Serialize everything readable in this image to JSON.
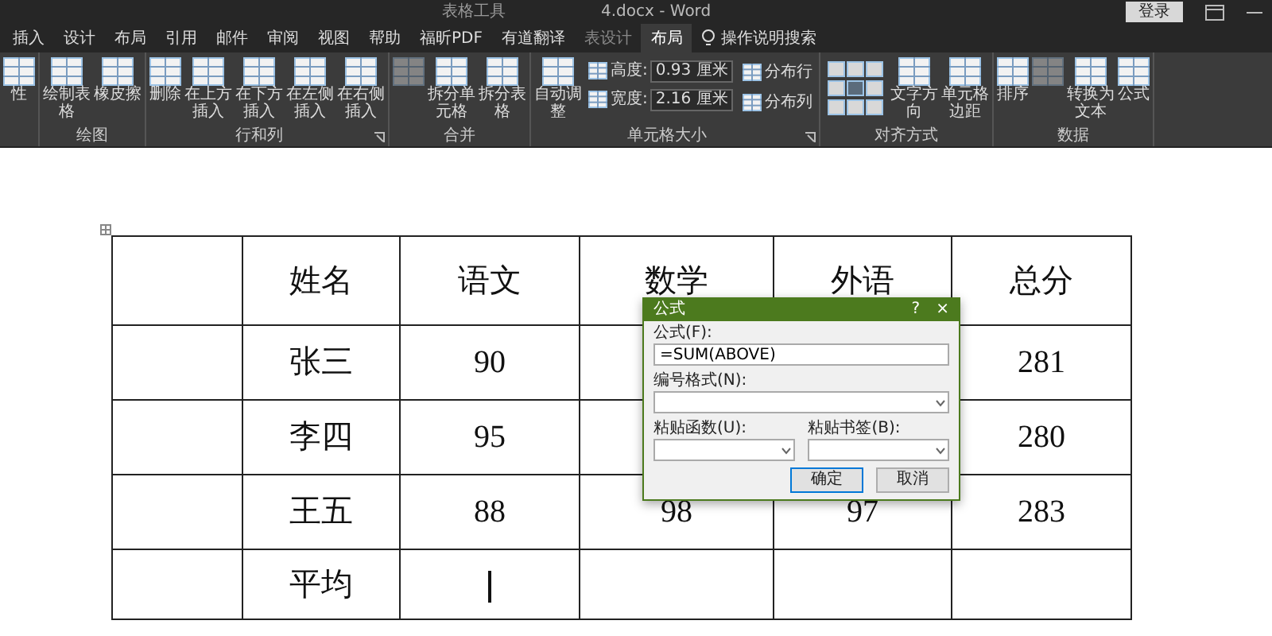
{
  "title_bar": {
    "context": "表格工具",
    "document": "4.docx - Word",
    "sign_in": "登录"
  },
  "tabs": [
    {
      "label": "插入",
      "selected": false
    },
    {
      "label": "设计",
      "selected": false
    },
    {
      "label": "布局",
      "selected": false
    },
    {
      "label": "引用",
      "selected": false
    },
    {
      "label": "邮件",
      "selected": false
    },
    {
      "label": "审阅",
      "selected": false
    },
    {
      "label": "视图",
      "selected": false
    },
    {
      "label": "帮助",
      "selected": false
    },
    {
      "label": "福昕PDF",
      "selected": false
    },
    {
      "label": "有道翻译",
      "selected": false
    },
    {
      "label": "表设计",
      "selected": false
    },
    {
      "label": "布局",
      "selected": true
    }
  ],
  "search": {
    "label": "操作说明搜索"
  },
  "ribbon": {
    "groups": [
      {
        "items": [
          {
            "kind": "large",
            "label": "性",
            "disabled": false
          }
        ]
      },
      {
        "label": "绘图",
        "launcher": false,
        "items": [
          {
            "kind": "large",
            "label": "绘制表格",
            "disabled": false
          },
          {
            "kind": "large",
            "label": "橡皮擦",
            "disabled": false
          }
        ]
      },
      {
        "label": "行和列",
        "launcher": true,
        "items": [
          {
            "kind": "large",
            "label": "删除",
            "disabled": false
          },
          {
            "kind": "large",
            "label": "在上方插入",
            "disabled": false
          },
          {
            "kind": "large",
            "label": "在下方插入",
            "disabled": false
          },
          {
            "kind": "large",
            "label": "在左侧插入",
            "disabled": false
          },
          {
            "kind": "large",
            "label": "在右侧插入",
            "disabled": false
          }
        ]
      },
      {
        "label": "合并",
        "launcher": false,
        "items": [
          {
            "kind": "large",
            "disabled": true
          },
          {
            "kind": "large",
            "label": "拆分单元格",
            "disabled": false
          },
          {
            "kind": "large",
            "label": "拆分表格",
            "disabled": false
          }
        ]
      },
      {
        "label": "单元格大小",
        "launcher": true,
        "items": [
          {
            "kind": "large",
            "label": "自动调整",
            "disabled": false
          },
          {
            "kind": "spin",
            "label": "高度:",
            "value": "0.93 厘米"
          },
          {
            "kind": "spin",
            "label": "宽度:",
            "value": "2.16 厘米"
          },
          {
            "kind": "small",
            "label": "分布行",
            "disabled": false
          },
          {
            "kind": "small",
            "label": "分布列",
            "disabled": false
          }
        ]
      },
      {
        "label": "对齐方式",
        "launcher": false,
        "items": [
          {
            "kind": "grid"
          },
          {
            "kind": "large",
            "label": "文字方向",
            "disabled": false
          },
          {
            "kind": "large",
            "label": "单元格边距",
            "disabled": false
          }
        ]
      },
      {
        "label": "数据",
        "launcher": false,
        "items": [
          {
            "kind": "large",
            "label": "排序",
            "disabled": false
          },
          {
            "kind": "large",
            "disabled": true
          },
          {
            "kind": "large",
            "label": "转换为文本",
            "disabled": false
          },
          {
            "kind": "large",
            "label": "公式",
            "disabled": false
          }
        ]
      }
    ]
  },
  "table": {
    "rows": [
      [
        null,
        "姓名",
        "语文",
        "数学",
        "外语",
        "总分"
      ],
      [
        null,
        "张三",
        "90",
        null,
        null,
        "281"
      ],
      [
        null,
        "李四",
        "95",
        null,
        null,
        "280"
      ],
      [
        null,
        "王五",
        "88",
        "98",
        "97",
        "283"
      ],
      [
        null,
        "平均",
        null,
        null,
        null,
        null
      ]
    ]
  },
  "dialog": {
    "title": "公式",
    "help": "?",
    "close": "×",
    "formula_label": "公式(F):",
    "formula_value": "=SUM(ABOVE)",
    "number_format_label": "编号格式(N):",
    "paste_function_label": "粘贴函数(U):",
    "paste_bookmark_label": "粘贴书签(B):",
    "ok": "确定",
    "cancel": "取消"
  }
}
